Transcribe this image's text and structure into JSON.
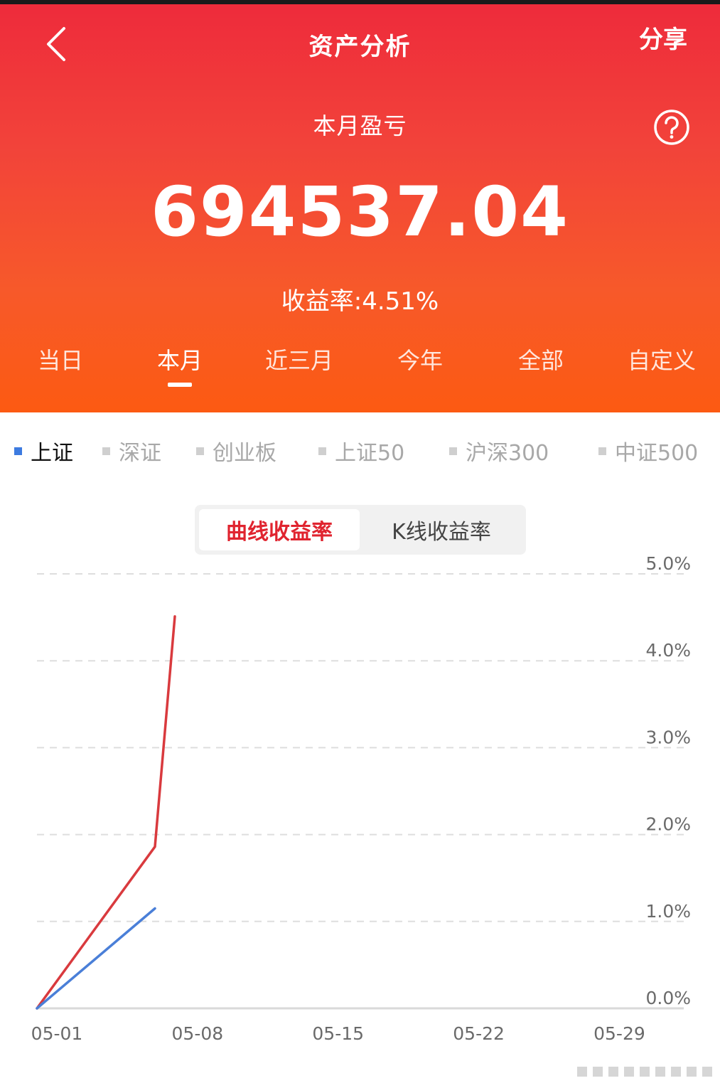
{
  "header": {
    "title": "资产分析",
    "share_label": "分享",
    "back_icon": "chevron-left-icon",
    "help_icon": "question-circle-icon"
  },
  "summary": {
    "label": "本月盈亏",
    "amount": "694537.04",
    "rate_text": "收益率:4.51%"
  },
  "periods": [
    "当日",
    "本月",
    "近三月",
    "今年",
    "全部",
    "自定义"
  ],
  "active_period": "本月",
  "benchmarks": [
    "上证",
    "深证",
    "创业板",
    "上证50",
    "沪深300",
    "中证500"
  ],
  "active_benchmark": "上证",
  "chart_tabs": [
    "曲线收益率",
    "K线收益率"
  ],
  "active_chart_tab": "曲线收益率",
  "colors": {
    "header_red": "#ee2b3b",
    "header_orange": "#fc5a12",
    "portfolio_line": "#d93a3e",
    "benchmark_line": "#4a7fd8",
    "active_tab_text": "#e0242f"
  },
  "chart_data": {
    "type": "line",
    "title": "",
    "xlabel": "",
    "ylabel": "",
    "x_ticks": [
      "05-01",
      "05-08",
      "05-15",
      "05-22",
      "05-29"
    ],
    "y_ticks": [
      "0.0%",
      "1.0%",
      "2.0%",
      "3.0%",
      "4.0%",
      "5.0%"
    ],
    "xlim": [
      "05-01",
      "05-31"
    ],
    "ylim": [
      0,
      5
    ],
    "grid": "horizontal-dashed",
    "y_axis_side": "right",
    "series": [
      {
        "x": [
          "05-01",
          "05-07",
          "05-08"
        ],
        "y": [
          0,
          1.86,
          4.51
        ],
        "color": "#d93a3e"
      },
      {
        "x": [
          "05-01",
          "05-07"
        ],
        "y": [
          0,
          1.15
        ],
        "color": "#4a7fd8"
      }
    ]
  }
}
